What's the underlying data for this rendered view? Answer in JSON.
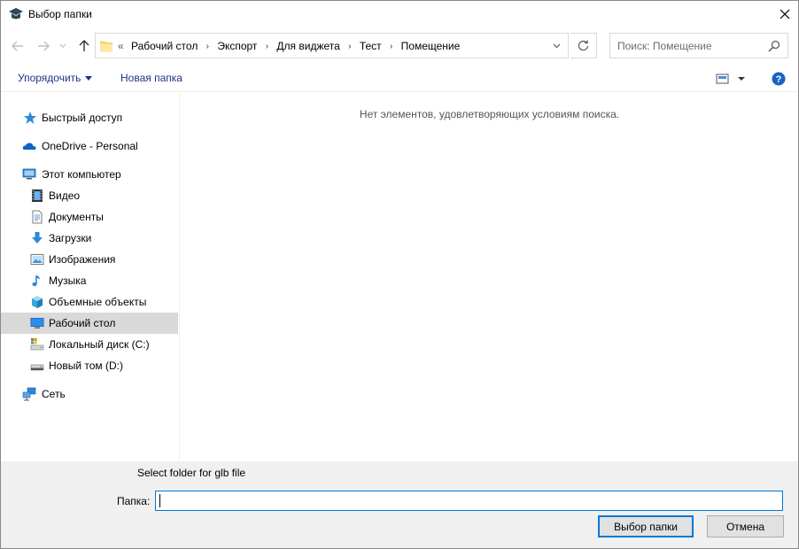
{
  "window": {
    "title": "Выбор папки"
  },
  "nav": {
    "back_icon": "arrow-left-icon",
    "forward_icon": "arrow-right-icon",
    "recent_icon": "chevron-down-icon",
    "up_icon": "arrow-up-icon",
    "overflow": "«",
    "breadcrumb": [
      "Рабочий стол",
      "Экспорт",
      "Для виджета",
      "Тест",
      "Помещение"
    ],
    "refresh_icon": "refresh-icon"
  },
  "search": {
    "placeholder": "Поиск: Помещение"
  },
  "toolbar": {
    "organize_label": "Упорядочить",
    "new_folder_label": "Новая папка"
  },
  "sidebar": {
    "quick_access": "Быстрый доступ",
    "onedrive": "OneDrive - Personal",
    "this_pc": "Этот компьютер",
    "items": [
      {
        "label": "Видео",
        "icon": "video-icon"
      },
      {
        "label": "Документы",
        "icon": "documents-icon"
      },
      {
        "label": "Загрузки",
        "icon": "downloads-icon"
      },
      {
        "label": "Изображения",
        "icon": "pictures-icon"
      },
      {
        "label": "Музыка",
        "icon": "music-icon"
      },
      {
        "label": "Объемные объекты",
        "icon": "3d-objects-icon"
      },
      {
        "label": "Рабочий стол",
        "icon": "desktop-icon"
      },
      {
        "label": "Локальный диск (C:)",
        "icon": "drive-icon"
      },
      {
        "label": "Новый том (D:)",
        "icon": "drive-icon"
      }
    ],
    "network": "Сеть"
  },
  "content": {
    "empty_message": "Нет элементов, удовлетворяющих условиям поиска."
  },
  "bottom": {
    "hint": "Select folder for glb file",
    "folder_label": "Папка:",
    "folder_value": "",
    "select_button": "Выбор папки",
    "cancel_button": "Отмена"
  },
  "colors": {
    "accent": "#0078d7",
    "link_blue": "#1e3287",
    "selected_bg": "#d9d9d9",
    "panel_bg": "#f0f0f0"
  }
}
